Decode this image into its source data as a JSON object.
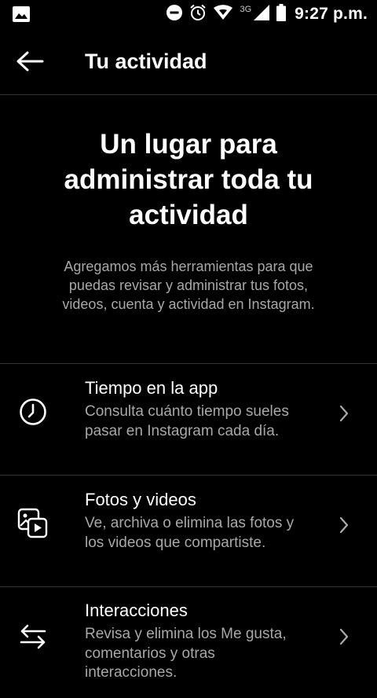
{
  "status_bar": {
    "network": "3G",
    "time": "9:27 p.m."
  },
  "header": {
    "title": "Tu actividad"
  },
  "hero": {
    "title": "Un lugar para administrar toda tu actividad",
    "description": "Agregamos más herramientas para que puedas revisar y administrar tus fotos, videos, cuenta y actividad en Instagram."
  },
  "items": [
    {
      "title": "Tiempo en la app",
      "description": "Consulta cuánto tiempo sueles pasar en Instagram cada día.",
      "icon": "clock-icon"
    },
    {
      "title": "Fotos y videos",
      "description": "Ve, archiva o elimina las fotos y los videos que compartiste.",
      "icon": "photos-videos-icon"
    },
    {
      "title": "Interacciones",
      "description": "Revisa y elimina los Me gusta, comentarios y otras interacciones.",
      "icon": "interactions-arrows-icon"
    }
  ],
  "colors": {
    "background": "#000000",
    "text_primary": "#ffffff",
    "text_secondary": "#a8a8a8",
    "divider": "#333333"
  }
}
